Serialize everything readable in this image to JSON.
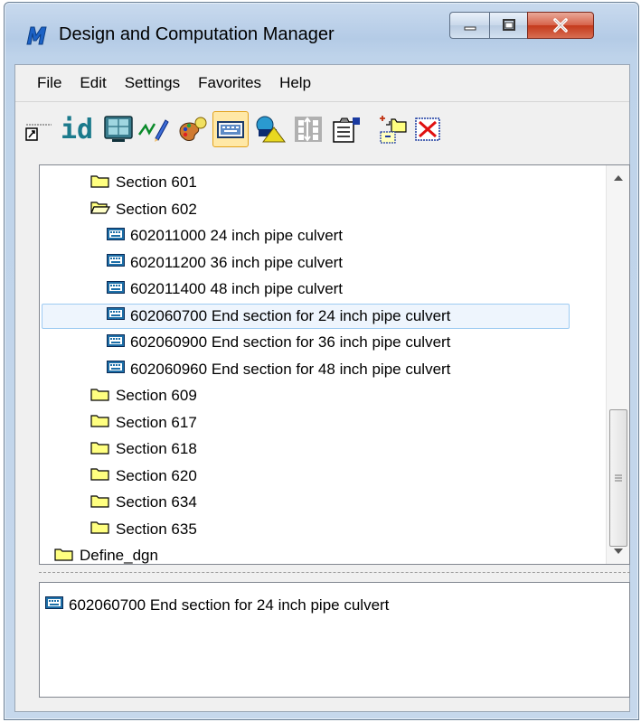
{
  "window": {
    "title": "Design and Computation Manager"
  },
  "menu": {
    "file": "File",
    "edit": "Edit",
    "settings": "Settings",
    "favorites": "Favorites",
    "help": "Help"
  },
  "toolbar": {
    "id_label": "id"
  },
  "tree": {
    "items": [
      {
        "label": "Section 601",
        "type": "folder"
      },
      {
        "label": "Section 602",
        "type": "folder-open"
      },
      {
        "label": "602011000 24 inch pipe culvert",
        "type": "item"
      },
      {
        "label": "602011200 36 inch pipe culvert",
        "type": "item"
      },
      {
        "label": "602011400 48 inch pipe culvert",
        "type": "item"
      },
      {
        "label": "602060700 End section for 24 inch pipe culvert",
        "type": "item",
        "selected": true
      },
      {
        "label": "602060900 End section for 36 inch pipe culvert",
        "type": "item"
      },
      {
        "label": "602060960 End section for 48 inch pipe culvert",
        "type": "item"
      },
      {
        "label": "Section 609",
        "type": "folder"
      },
      {
        "label": "Section 617",
        "type": "folder"
      },
      {
        "label": "Section 618",
        "type": "folder"
      },
      {
        "label": "Section 620",
        "type": "folder"
      },
      {
        "label": "Section 634",
        "type": "folder"
      },
      {
        "label": "Section 635",
        "type": "folder"
      },
      {
        "label": "Define_dgn",
        "type": "folder"
      }
    ]
  },
  "detail": {
    "label": "602060700 End section for 24 inch pipe culvert"
  },
  "colors": {
    "folder": "#ffff80",
    "selection_bg": "#eef5fd",
    "selection_border": "#9ecbf2",
    "close_button": "#c4391b"
  }
}
